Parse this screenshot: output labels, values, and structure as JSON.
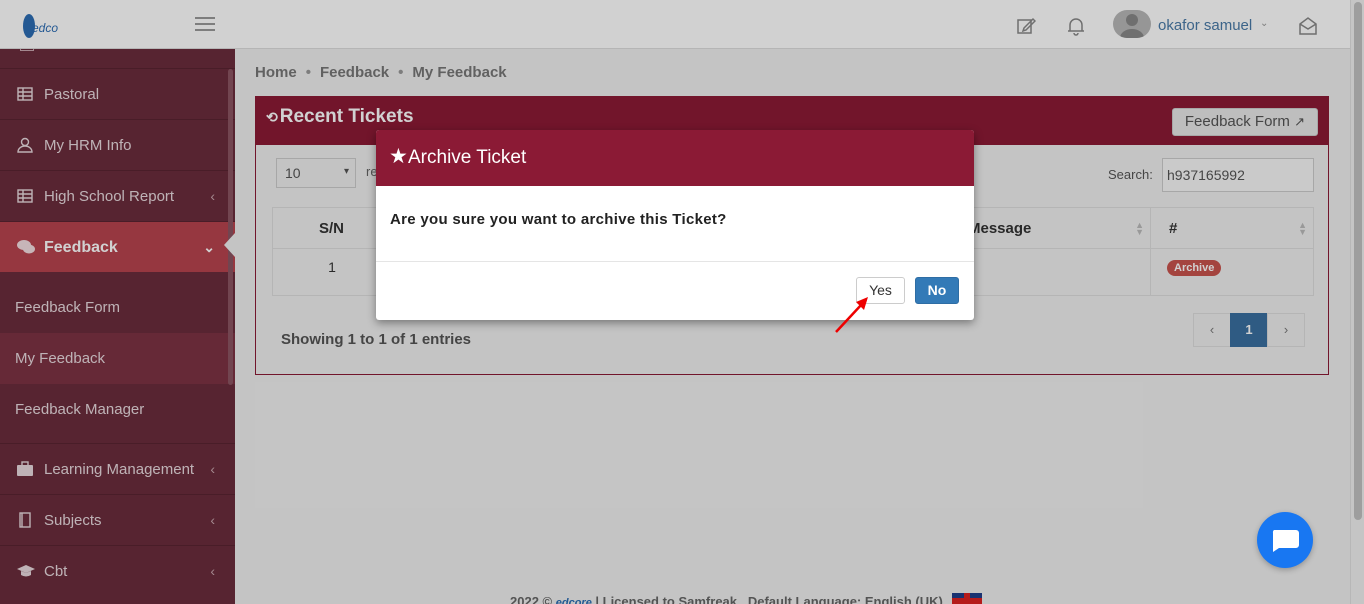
{
  "topbar": {
    "user_name": "okafor samuel"
  },
  "sidebar": {
    "items": [
      {
        "label": "Pastoral",
        "icon": "table-icon"
      },
      {
        "label": "My HRM Info",
        "icon": "user-icon"
      },
      {
        "label": "High School Report",
        "icon": "table-icon"
      },
      {
        "label": "Feedback",
        "icon": "comments-icon"
      },
      {
        "label": "Learning Management",
        "icon": "briefcase-icon"
      },
      {
        "label": "Subjects",
        "icon": "book-icon"
      },
      {
        "label": "Cbt",
        "icon": "graduation-cap-icon"
      }
    ],
    "sub_items": [
      {
        "label": "Feedback Form"
      },
      {
        "label": "My Feedback"
      },
      {
        "label": "Feedback Manager"
      }
    ]
  },
  "breadcrumb": {
    "home": "Home",
    "feedback": "Feedback",
    "current": "My Feedback",
    "sep": "•"
  },
  "panel": {
    "title": "Recent Tickets",
    "form_button": "Feedback Form",
    "length_value": "10",
    "length_suffix": "re",
    "search_label": "Search:",
    "search_value": "h937165992",
    "columns": {
      "sn": "S/N",
      "message": "Message",
      "hash": "#"
    },
    "row": {
      "sn": "1",
      "action": "Archive"
    },
    "info": "Showing 1 to 1 of 1 entries",
    "pager": {
      "prev": "‹",
      "page": "1",
      "next": "›"
    }
  },
  "footer": {
    "text": "2022 ©",
    "license": "|  Licensed to Samfreak",
    "language": "Default Language: English (UK)"
  },
  "modal": {
    "title": "Archive Ticket",
    "star": "★",
    "body": "Are you sure you want to archive this Ticket?",
    "yes": "Yes",
    "no": "No"
  },
  "colors": {
    "brand": "#8b1a35",
    "sidebar": "#6b2d3c",
    "sidebar_active": "#b8444f",
    "primary": "#337ab7",
    "chat": "#1877f2"
  }
}
